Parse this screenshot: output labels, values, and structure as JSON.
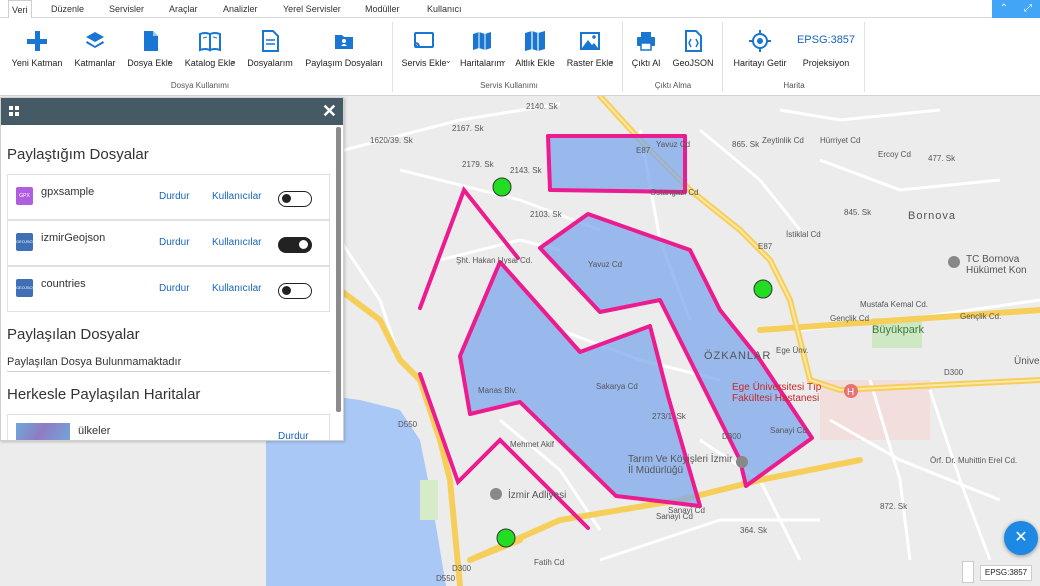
{
  "tabs": [
    "Veri",
    "Düzenle",
    "Servisler",
    "Araçlar",
    "Analizler",
    "Yerel Servisler",
    "Modüller",
    "Kullanıcı"
  ],
  "ribbon": {
    "buttons": [
      {
        "label": "Yeni Katman",
        "icon": "plus-icon"
      },
      {
        "label": "Katmanlar",
        "icon": "layers-icon"
      },
      {
        "label": "Dosya Ekle",
        "icon": "file-icon"
      },
      {
        "label": "Katalog Ekle",
        "icon": "book-icon"
      },
      {
        "label": "Dosyalarım",
        "icon": "document-icon"
      },
      {
        "label": "Paylaşım Dosyaları",
        "icon": "shared-folder-icon"
      },
      {
        "label": "Servis Ekle",
        "icon": "cast-icon"
      },
      {
        "label": "Haritalarım",
        "icon": "map-icon"
      },
      {
        "label": "Altlık Ekle",
        "icon": "basemap-icon"
      },
      {
        "label": "Raster Ekle",
        "icon": "image-icon"
      },
      {
        "label": "Çıktı Al",
        "icon": "printer-icon"
      },
      {
        "label": "GeoJSON",
        "icon": "code-file-icon"
      },
      {
        "label": "Haritayı Getir",
        "icon": "crosshair-icon"
      },
      {
        "label": "Projeksiyon",
        "icon": "projection-icon"
      }
    ],
    "projection_code": "EPSG:3857",
    "groups": [
      "Dosya Kullanımı",
      "Servis Kullanımı",
      "Çıktı Alma",
      "Harita"
    ]
  },
  "panel": {
    "my_shared_title": "Paylaştığım Dosyalar",
    "files": [
      {
        "name": "gpxsample",
        "type": "GPX",
        "stop": "Durdur",
        "users": "Kullanıcılar",
        "enabled": false
      },
      {
        "name": "izmirGeojson",
        "type": "GEOJSON",
        "stop": "Durdur",
        "users": "Kullanıcılar",
        "enabled": true
      },
      {
        "name": "countries",
        "type": "GEOJSON",
        "stop": "Durdur",
        "users": "Kullanıcılar",
        "enabled": false
      }
    ],
    "shared_with_me_title": "Paylaşılan Dosyalar",
    "no_shared_text": "Paylaşılan Dosya Bulunmamaktadır",
    "public_maps_title": "Herkesle Paylaşılan Haritalar",
    "public_maps": [
      {
        "name": "ülkeler",
        "stop": "Durdur"
      }
    ]
  },
  "map": {
    "labels": [
      "2140. Sk",
      "2167. Sk",
      "1620/39. Sk",
      "2143. Sk",
      "2179. Sk",
      "2103. Sk",
      "Şht. Hakan Uysal Cd.",
      "Yavuz Cd",
      "Yavuz Cd",
      "Ostangazi Cd",
      "E87",
      "865. Sk",
      "Zeytinlik Cd",
      "Hürriyet Cd",
      "Ercoy Cd",
      "477. Sk",
      "845. Sk",
      "İstiklal Cd",
      "E87",
      "Mustafa Kemal Cd.",
      "Gençlik Cd",
      "Ege Ünv.",
      "Manas Blv.",
      "Sakarya Cd",
      "273/1. Sk",
      "Sanayi Cd",
      "Sanayi Cd",
      "364. Sk",
      "D550",
      "D550",
      "D300",
      "D300",
      "D300",
      "Mehmet Akif",
      "Fatih Cd",
      "872. Sk",
      "Örf. Dr. Muhittin Erel Cd.",
      "Gençlik Cd.",
      "Sanayi Cd"
    ],
    "places": [
      "Bornova",
      "ÖZKANLAR",
      "Büyükpark",
      "TC Bornova Hükümet Kon",
      "Ege Üniversitesi Tıp Fakültesi Hastanesi",
      "Tarım Ve Köyişleri İzmir İl Müdürlüğü",
      "İzmir Adliyesi",
      "Ünive"
    ],
    "projection_badge": "EPSG:3857"
  },
  "colors": {
    "accent": "#1565c0",
    "panel_header": "#455a64",
    "polygon_fill": "#7ea8ee",
    "polygon_stroke": "#ec1c8f",
    "marker": "#22dd22",
    "water": "#aac8f5"
  }
}
